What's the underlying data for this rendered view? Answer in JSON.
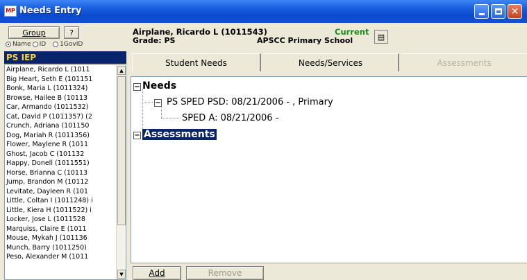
{
  "window": {
    "title": "Needs Entry",
    "app_icon_text": "MP"
  },
  "left_panel": {
    "group_label": "Group",
    "help_label": "?",
    "radio_options": [
      "Name",
      "ID",
      "1GovID"
    ],
    "selected_radio": "Name",
    "list_title": "PS IEP",
    "students": [
      "Airplane, Ricardo L (1011",
      "Big Heart, Seth E (101151",
      "Bonk, Maria L (1011324)",
      "Browse, Hailee B (10113",
      "Car, Armando (1011532)",
      "Cat, David P (1011357) (2",
      "Crunch, Adriana (101150",
      "Dog, Mariah R (1011356)",
      "Flower, Maylene R (1011",
      "Ghost, Jacob C (101132",
      "Happy, Donell (1011551)",
      "Horse, Brianna C (10113",
      "Jump, Brandon M (10112",
      "Levitate, Dayleen R (101",
      "Little, Coltan I (1011248) i",
      "Little, Kiera H (1011522) i",
      "Locker, Jose L (1011528",
      "Marquiss, Claire E (1011",
      "Mouse, Mykah J (101136",
      "Munch, Barry (1011250)",
      "Peso, Alexander M (1011"
    ]
  },
  "header": {
    "student_name": "Airplane, Ricardo L (1011543)",
    "grade": "Grade: PS",
    "status": "Current",
    "school": "APSCC Primary School"
  },
  "tabs": [
    {
      "label": "Student Needs",
      "active": true,
      "enabled": true
    },
    {
      "label": "Needs/Services",
      "active": false,
      "enabled": true
    },
    {
      "label": "Assessments",
      "active": false,
      "enabled": false
    }
  ],
  "tree": {
    "needs_label": "Needs",
    "ps_sped_label": "PS SPED PSD: 08/21/2006 - , Primary",
    "sped_a_label": "SPED A: 08/21/2006 -",
    "assessments_label": "Assessments"
  },
  "buttons": {
    "add": "Add",
    "remove": "Remove"
  },
  "colors": {
    "titlebar": "#0b4ad0",
    "list_header_bg": "#08246b",
    "list_header_text": "#ffd33a",
    "current_status": "#1b8a1b",
    "selection": "#0a246a"
  }
}
